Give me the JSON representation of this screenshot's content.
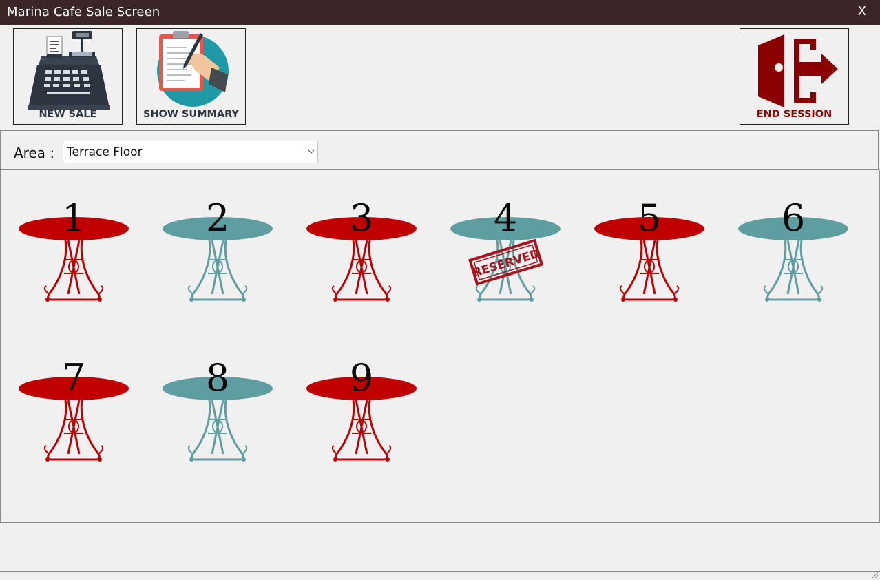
{
  "window": {
    "title": "Marina Cafe Sale Screen",
    "close_label": "X"
  },
  "toolbar": {
    "new_sale_label": "NEW SALE",
    "show_summary_label": "SHOW SUMMARY",
    "end_session_label": "END SESSION"
  },
  "area": {
    "label": "Area :",
    "selected": "Terrace Floor"
  },
  "colors": {
    "occupied": "#c00000",
    "available": "#5f9ea0",
    "stamp": "#a8131c"
  },
  "tables": [
    {
      "number": "1",
      "status": "occupied"
    },
    {
      "number": "2",
      "status": "available"
    },
    {
      "number": "3",
      "status": "occupied"
    },
    {
      "number": "4",
      "status": "reserved",
      "stamp": "RESERVED"
    },
    {
      "number": "5",
      "status": "occupied"
    },
    {
      "number": "6",
      "status": "available"
    },
    {
      "number": "7",
      "status": "occupied"
    },
    {
      "number": "8",
      "status": "available"
    },
    {
      "number": "9",
      "status": "occupied"
    }
  ]
}
